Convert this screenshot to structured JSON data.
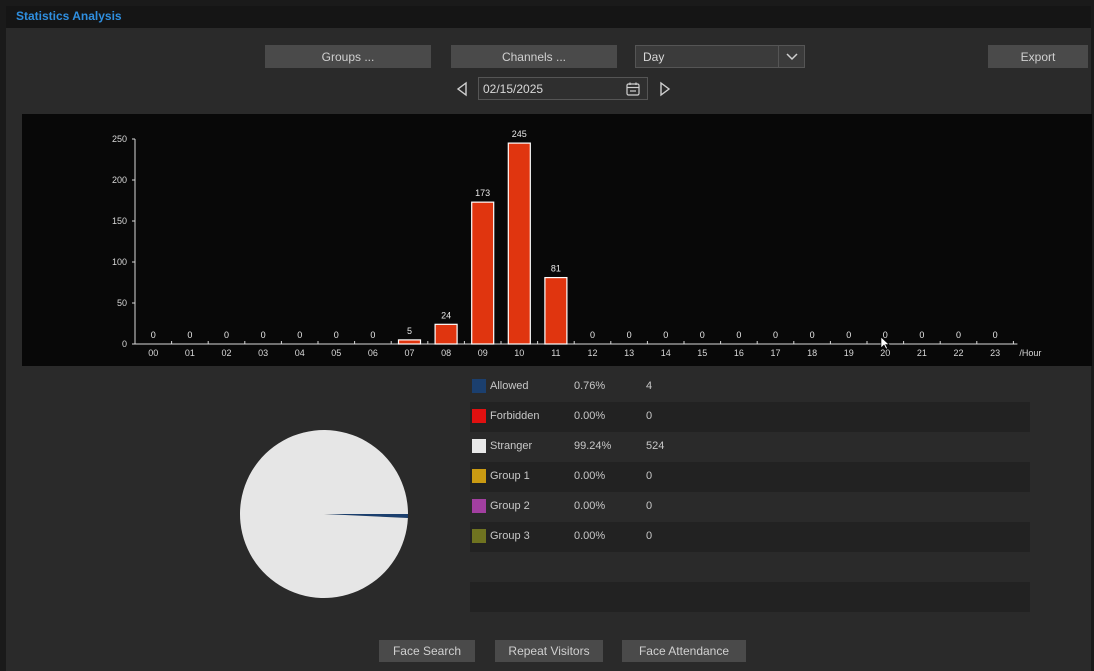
{
  "window": {
    "title": "Statistics Analysis"
  },
  "toolbar": {
    "groups_label": "Groups ...",
    "channels_label": "Channels ...",
    "period_value": "Day",
    "export_label": "Export"
  },
  "date": {
    "value": "02/15/2025"
  },
  "chart_data": {
    "type": "bar",
    "categories": [
      "00",
      "01",
      "02",
      "03",
      "04",
      "05",
      "06",
      "07",
      "08",
      "09",
      "10",
      "11",
      "12",
      "13",
      "14",
      "15",
      "16",
      "17",
      "18",
      "19",
      "20",
      "21",
      "22",
      "23"
    ],
    "values": [
      0,
      0,
      0,
      0,
      0,
      0,
      0,
      5,
      24,
      173,
      245,
      81,
      0,
      0,
      0,
      0,
      0,
      0,
      0,
      0,
      0,
      0,
      0,
      0
    ],
    "ylim": [
      0,
      250
    ],
    "yticks": [
      0,
      50,
      100,
      150,
      200,
      250
    ],
    "xunit": "/Hour",
    "bar_color": "#e0350f"
  },
  "pie_data": {
    "type": "pie",
    "slices": [
      {
        "name": "Allowed",
        "percent": 0.76,
        "count": 4,
        "color": "#1b3f6e"
      },
      {
        "name": "Stranger",
        "percent": 99.24,
        "count": 524,
        "color": "#e6e6e6"
      }
    ]
  },
  "legend": [
    {
      "name": "Allowed",
      "percent": "0.76%",
      "count": "4",
      "color": "#1b3f6e"
    },
    {
      "name": "Forbidden",
      "percent": "0.00%",
      "count": "0",
      "color": "#e01010"
    },
    {
      "name": "Stranger",
      "percent": "99.24%",
      "count": "524",
      "color": "#e8e8e8"
    },
    {
      "name": "Group 1",
      "percent": "0.00%",
      "count": "0",
      "color": "#c99a12"
    },
    {
      "name": "Group 2",
      "percent": "0.00%",
      "count": "0",
      "color": "#a23fa0"
    },
    {
      "name": "Group 3",
      "percent": "0.00%",
      "count": "0",
      "color": "#6f7320"
    }
  ],
  "footer": {
    "face_search_label": "Face Search",
    "repeat_visitors_label": "Repeat Visitors",
    "face_attendance_label": "Face Attendance"
  }
}
